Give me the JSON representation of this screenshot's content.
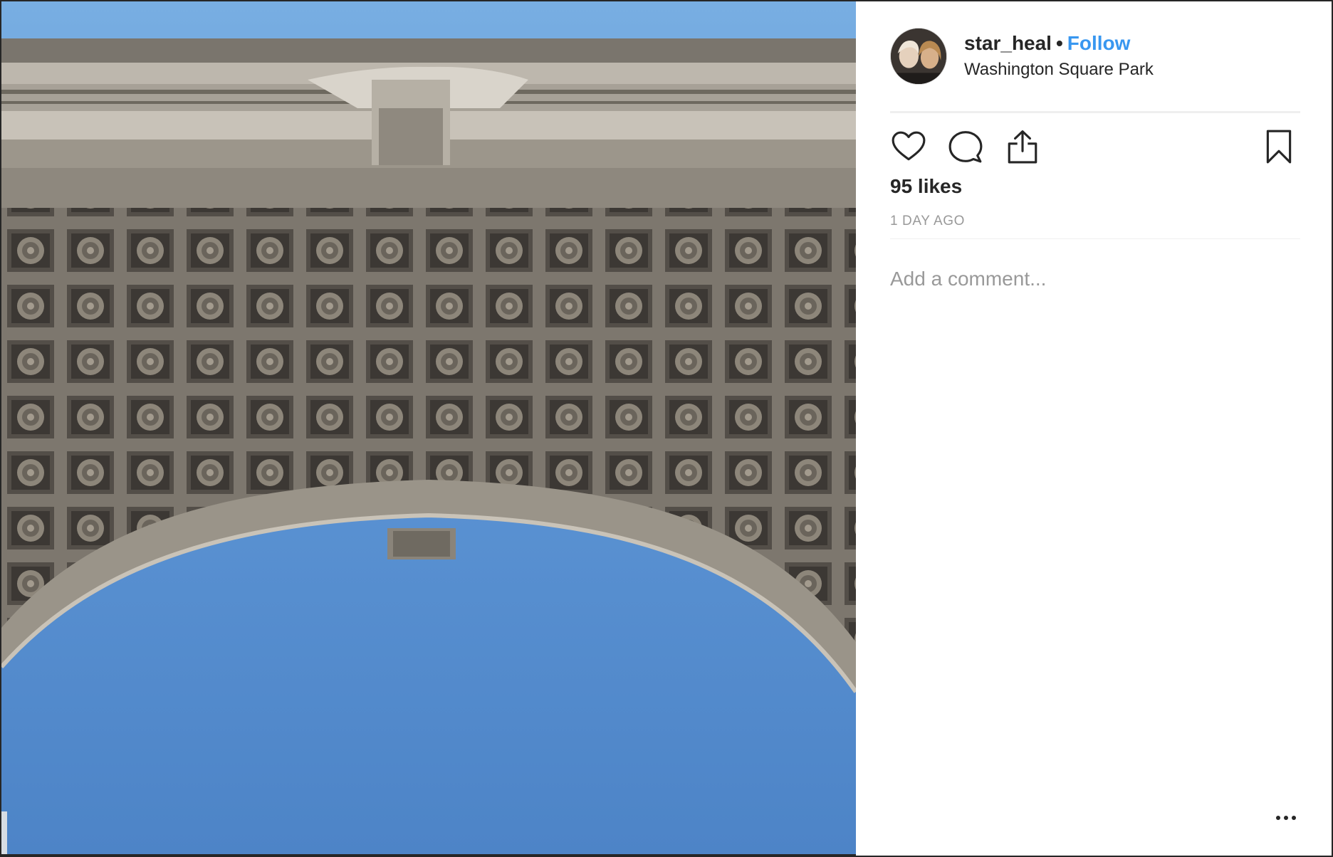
{
  "post": {
    "image_alt": "",
    "photo_subject": "arch-coffered-ceiling"
  },
  "author": {
    "username": "star_heal",
    "separator": "•",
    "follow_label": "Follow",
    "location": "Washington Square Park"
  },
  "actions": {
    "like_icon": "heart-icon",
    "comment_icon": "speech-bubble-icon",
    "share_icon": "share-upload-icon",
    "save_icon": "bookmark-icon"
  },
  "stats": {
    "likes_text": "95 likes",
    "timestamp": "1 DAY AGO"
  },
  "comment": {
    "placeholder": "Add a comment..."
  },
  "more": {
    "icon": "more-options-icon"
  },
  "colors": {
    "link_blue": "#3897f0",
    "text_primary": "#262626",
    "text_secondary": "#999999",
    "sky_blue": "#5b93d3",
    "stone": "#8a8479"
  }
}
